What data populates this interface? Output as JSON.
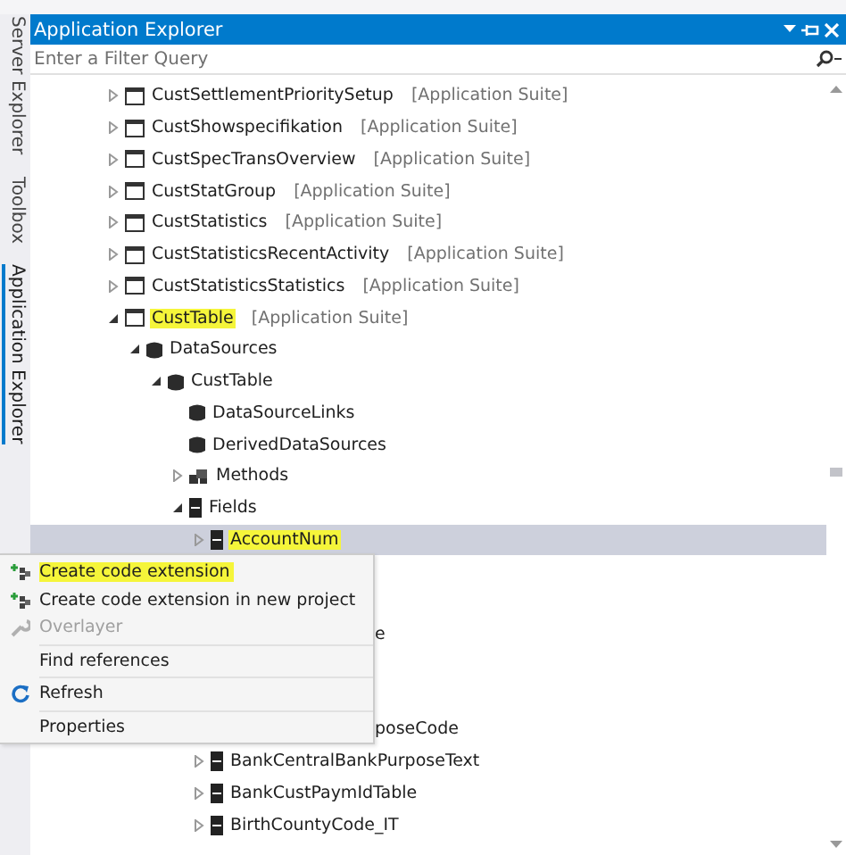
{
  "side_tabs": [
    {
      "label": "Server Explorer",
      "selected": false
    },
    {
      "label": "Toolbox",
      "selected": false
    },
    {
      "label": "Application Explorer",
      "selected": true
    }
  ],
  "window": {
    "title": "Application Explorer"
  },
  "filter": {
    "placeholder": "Enter a Filter Query"
  },
  "tree": [
    {
      "kind": "table",
      "label": "CustSettlementPrioritySetup",
      "layer": "[Application Suite]",
      "expanded": false,
      "selected": false,
      "marked": false
    },
    {
      "kind": "table",
      "label": "CustShowspecifikation",
      "layer": "[Application Suite]",
      "expanded": false,
      "selected": false,
      "marked": false
    },
    {
      "kind": "table",
      "label": "CustSpecTransOverview",
      "layer": "[Application Suite]",
      "expanded": false,
      "selected": false,
      "marked": false
    },
    {
      "kind": "table",
      "label": "CustStatGroup",
      "layer": "[Application Suite]",
      "expanded": false,
      "selected": false,
      "marked": false
    },
    {
      "kind": "table",
      "label": "CustStatistics",
      "layer": "[Application Suite]",
      "expanded": false,
      "selected": false,
      "marked": false
    },
    {
      "kind": "table",
      "label": "CustStatisticsRecentActivity",
      "layer": "[Application Suite]",
      "expanded": false,
      "selected": false,
      "marked": false
    },
    {
      "kind": "table",
      "label": "CustStatisticsStatistics",
      "layer": "[Application Suite]",
      "expanded": false,
      "selected": false,
      "marked": false
    },
    {
      "kind": "table",
      "label": "CustTable",
      "layer": "[Application Suite]",
      "expanded": true,
      "selected": false,
      "marked": true,
      "children": [
        {
          "kind": "datasource",
          "label": "DataSources",
          "expanded": true,
          "selected": false,
          "marked": false,
          "children": [
            {
              "kind": "datasource",
              "label": "CustTable",
              "expanded": true,
              "selected": false,
              "marked": false,
              "children": [
                {
                  "kind": "datasource",
                  "label": "DataSourceLinks",
                  "selected": false,
                  "marked": false
                },
                {
                  "kind": "datasource",
                  "label": "DerivedDataSources",
                  "selected": false,
                  "marked": false
                },
                {
                  "kind": "methods",
                  "label": "Methods",
                  "expanded": false,
                  "selected": false,
                  "marked": false
                },
                {
                  "kind": "field",
                  "label": "Fields",
                  "expanded": true,
                  "selected": false,
                  "marked": false,
                  "children": [
                    {
                      "kind": "field",
                      "label": "AccountNum",
                      "expanded": false,
                      "selected": true,
                      "marked": true
                    },
                    {
                      "kind": "hidden"
                    },
                    {
                      "kind": "hidden"
                    },
                    {
                      "kind": "covered",
                      "label": "e"
                    },
                    {
                      "kind": "hidden"
                    },
                    {
                      "kind": "hidden"
                    },
                    {
                      "kind": "covered",
                      "label": "poseCode"
                    },
                    {
                      "kind": "field",
                      "label": "BankCentralBankPurposeText",
                      "expanded": false,
                      "selected": false,
                      "marked": false
                    },
                    {
                      "kind": "field",
                      "label": "BankCustPaymIdTable",
                      "expanded": false,
                      "selected": false,
                      "marked": false
                    },
                    {
                      "kind": "field",
                      "label": "BirthCountyCode_IT",
                      "expanded": false,
                      "selected": false,
                      "marked": false
                    }
                  ]
                }
              ]
            }
          ]
        }
      ]
    }
  ],
  "context_menu": [
    {
      "kind": "extension",
      "label": "Create code extension",
      "disabled": false,
      "marked": true
    },
    {
      "kind": "extension",
      "label": "Create code extension in new project",
      "disabled": false,
      "marked": false
    },
    {
      "kind": "overlayer",
      "label": "Overlayer",
      "disabled": true,
      "marked": false
    },
    {
      "kind": "separator"
    },
    {
      "kind": "plain",
      "label": "Find references",
      "disabled": false,
      "marked": false
    },
    {
      "kind": "separator"
    },
    {
      "kind": "refresh",
      "label": "Refresh",
      "disabled": false,
      "marked": false
    },
    {
      "kind": "separator"
    },
    {
      "kind": "plain",
      "label": "Properties",
      "disabled": false,
      "marked": false
    }
  ]
}
